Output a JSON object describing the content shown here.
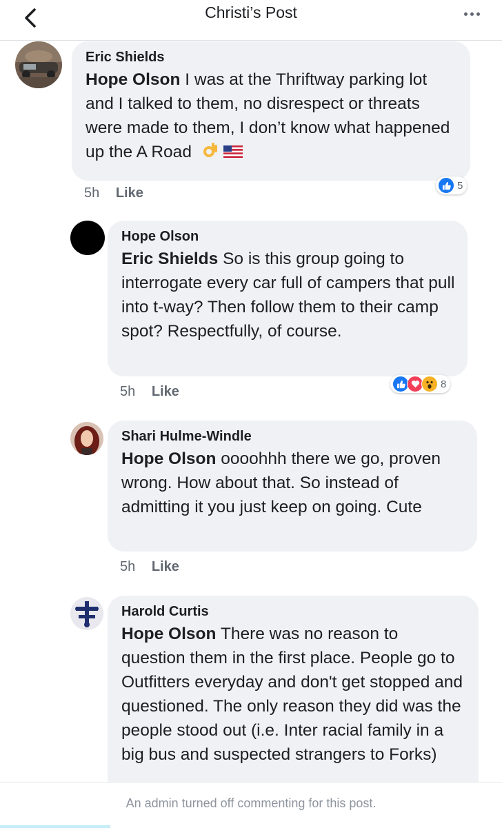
{
  "header": {
    "title": "Christi’s Post"
  },
  "comments": [
    {
      "author": "Eric Shields",
      "mention": "Hope Olson",
      "text": "I was at the Thriftway parking lot and I talked to them, no disrespect or threats were made to them, I don’t know what happened up the A Road",
      "emoji": [
        "ok-hand-icon",
        "us-flag-icon"
      ],
      "time": "5h",
      "like_label": "Like",
      "reaction_count": "5",
      "reactions": [
        "like"
      ]
    },
    {
      "author": "Hope Olson",
      "mention": "Eric Shields",
      "text": "So is this group going to interrogate every car full of campers that pull into t-way? Then follow them to their camp spot? Respectfully, of course.",
      "time": "5h",
      "like_label": "Like",
      "reaction_count": "8",
      "reactions": [
        "like",
        "love",
        "wow"
      ]
    },
    {
      "author": "Shari Hulme-Windle",
      "mention": "Hope Olson",
      "text": "oooohhh there we go, proven wrong. How about that. So instead of admitting it you just keep on going. Cute",
      "time": "5h",
      "like_label": "Like"
    },
    {
      "author": "Harold Curtis",
      "mention": "Hope Olson",
      "text": "There was no reason to question them in the first place. People go to Outfitters everyday and don't get stopped and questioned.  The only reason they did was the people stood out (i.e. Inter racial family in a big bus and suspected strangers to Forks)"
    }
  ],
  "footer": {
    "notice": "An admin turned off commenting for this post."
  },
  "colors": {
    "like": "#1877f2",
    "love": "#f33e58",
    "wow": "#f7b125",
    "bubble": "#f0f1f4"
  }
}
